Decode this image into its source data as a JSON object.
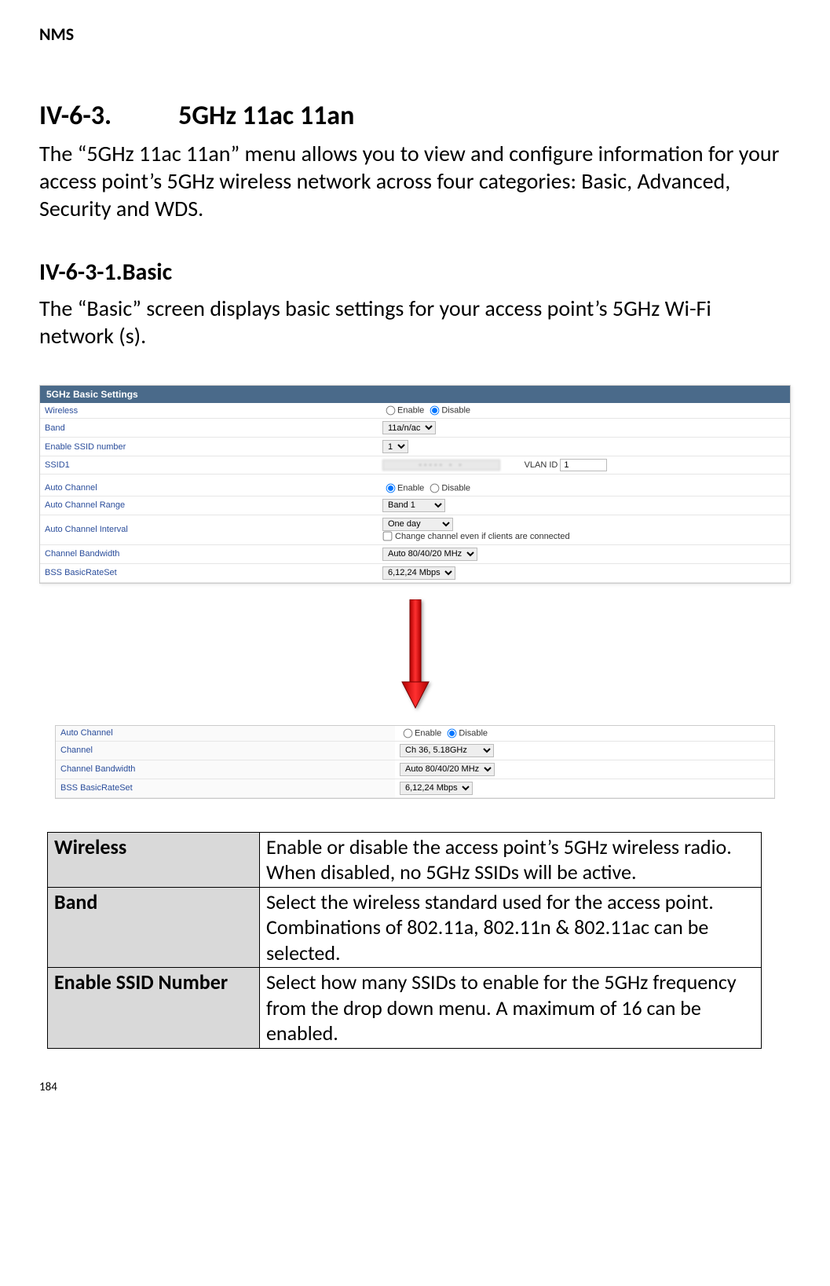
{
  "header": "NMS",
  "section": {
    "num": "IV-6-3.",
    "title": "5GHz 11ac 11an"
  },
  "intro": "The “5GHz 11ac 11an” menu allows you to view and configure information for your access point’s 5GHz wireless network across four categories: Basic, Advanced, Security and WDS.",
  "subsection": {
    "num": "IV-6-3-1.",
    "title": "Basic"
  },
  "subintro": "The “Basic” screen displays basic settings for your access point’s 5GHz Wi-Fi network (s).",
  "ui1": {
    "title": "5GHz Basic Settings",
    "rows": {
      "wireless": {
        "label": "Wireless",
        "radio1": "Enable",
        "radio2": "Disable"
      },
      "band": {
        "label": "Band",
        "value": "11a/n/ac"
      },
      "enable_ssid": {
        "label": "Enable SSID number",
        "value": "1"
      },
      "ssid1": {
        "label": "SSID1",
        "value_placeholder": "▪▪▪▪▪ ▪ ▪",
        "vlan_label": "VLAN ID",
        "vlan_value": "1"
      },
      "auto_channel": {
        "label": "Auto Channel",
        "radio1": "Enable",
        "radio2": "Disable"
      },
      "auto_range": {
        "label": "Auto Channel Range",
        "value": "Band 1"
      },
      "auto_interval": {
        "label": "Auto Channel Interval",
        "value": "One day",
        "checkbox": "Change channel even if clients are connected"
      },
      "ch_bw": {
        "label": "Channel Bandwidth",
        "value": "Auto 80/40/20 MHz"
      },
      "bss": {
        "label": "BSS BasicRateSet",
        "value": "6,12,24 Mbps"
      }
    }
  },
  "ui2": {
    "rows": {
      "auto_channel": {
        "label": "Auto Channel",
        "radio1": "Enable",
        "radio2": "Disable"
      },
      "channel": {
        "label": "Channel",
        "value": "Ch 36, 5.18GHz"
      },
      "ch_bw": {
        "label": "Channel Bandwidth",
        "value": "Auto 80/40/20 MHz"
      },
      "bss": {
        "label": "BSS BasicRateSet",
        "value": "6,12,24 Mbps"
      }
    }
  },
  "desc": {
    "rows": [
      {
        "h": "Wireless",
        "t": "Enable or disable the access point’s 5GHz wireless radio. When disabled, no 5GHz SSIDs will be active."
      },
      {
        "h": "Band",
        "t": "Select the wireless standard used for the access point. Combinations of 802.11a, 802.11n & 802.11ac can be selected."
      },
      {
        "h": "Enable SSID Number",
        "t": "Select how many SSIDs to enable for the 5GHz frequency from the drop down menu. A maximum of 16 can be enabled."
      }
    ]
  },
  "page_num": "184"
}
